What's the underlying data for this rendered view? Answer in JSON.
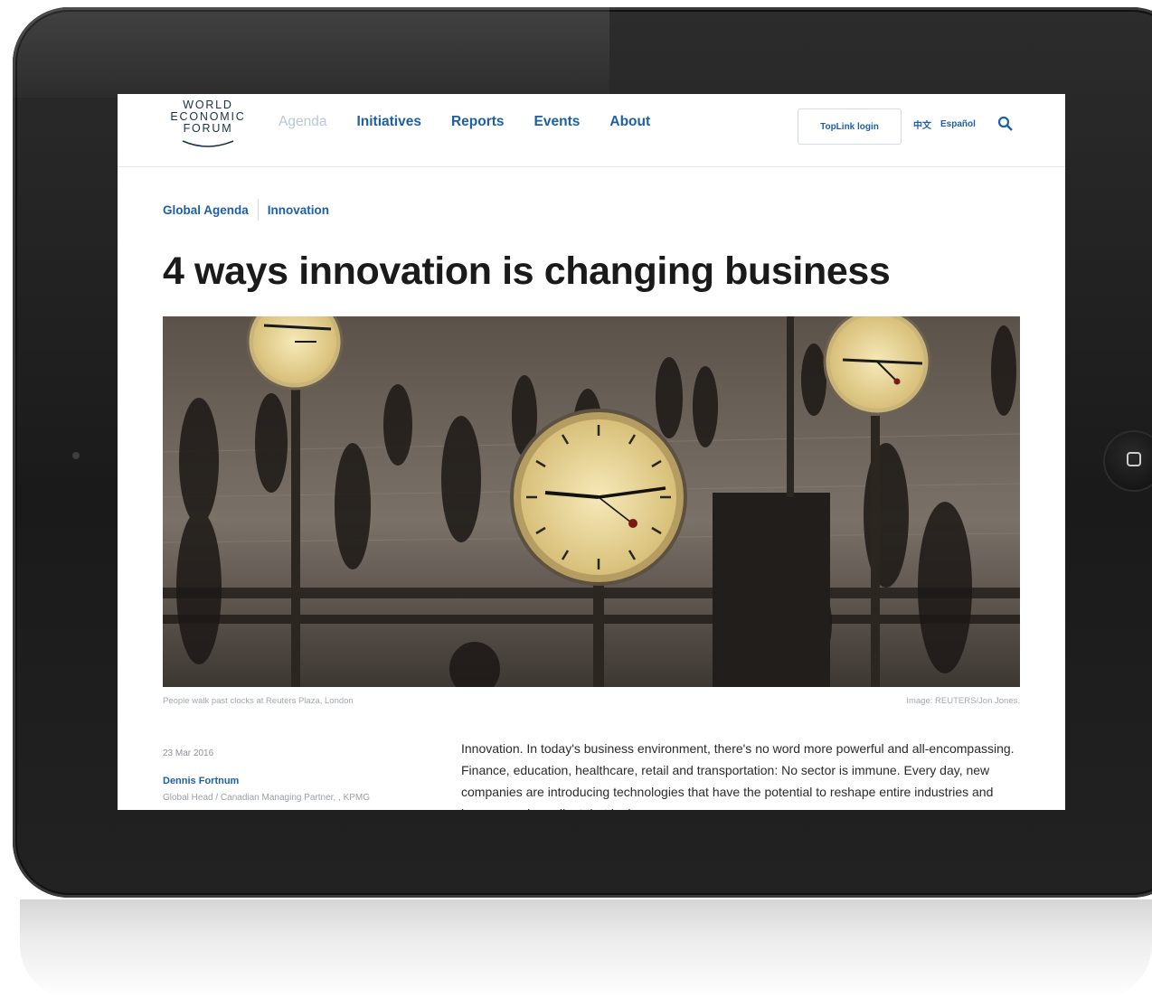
{
  "header": {
    "logo_lines": [
      "WORLD",
      "ECONOMIC",
      "FORUM"
    ],
    "nav": [
      "Agenda",
      "Initiatives",
      "Reports",
      "Events",
      "About"
    ],
    "toplink_label": "TopLink login",
    "lang_label": "Español"
  },
  "breadcrumb": [
    "Global Agenda",
    "Innovation"
  ],
  "article": {
    "title": "4 ways innovation is changing business",
    "caption": "People walk past clocks at Reuters Plaza, London",
    "credit": "Image: REUTERS/Jon Jones.",
    "date": "23 Mar 2016",
    "author": "Dennis Fortnum",
    "author_role": "Global Head / Canadian Managing Partner, , KPMG",
    "body": "Innovation. In today's business environment, there's no word more powerful and all-encompassing. Finance, education, healthcare, retail and transportation: No sector is immune. Every day, new companies are introducing technologies that have the potential to reshape entire industries and become an ingredient that is d"
  },
  "colors": {
    "brand_blue": "#1d5fa6",
    "dim_nav": "#b9c7d6",
    "title": "#1a1a1a",
    "bezel": "#1a1a1a"
  }
}
